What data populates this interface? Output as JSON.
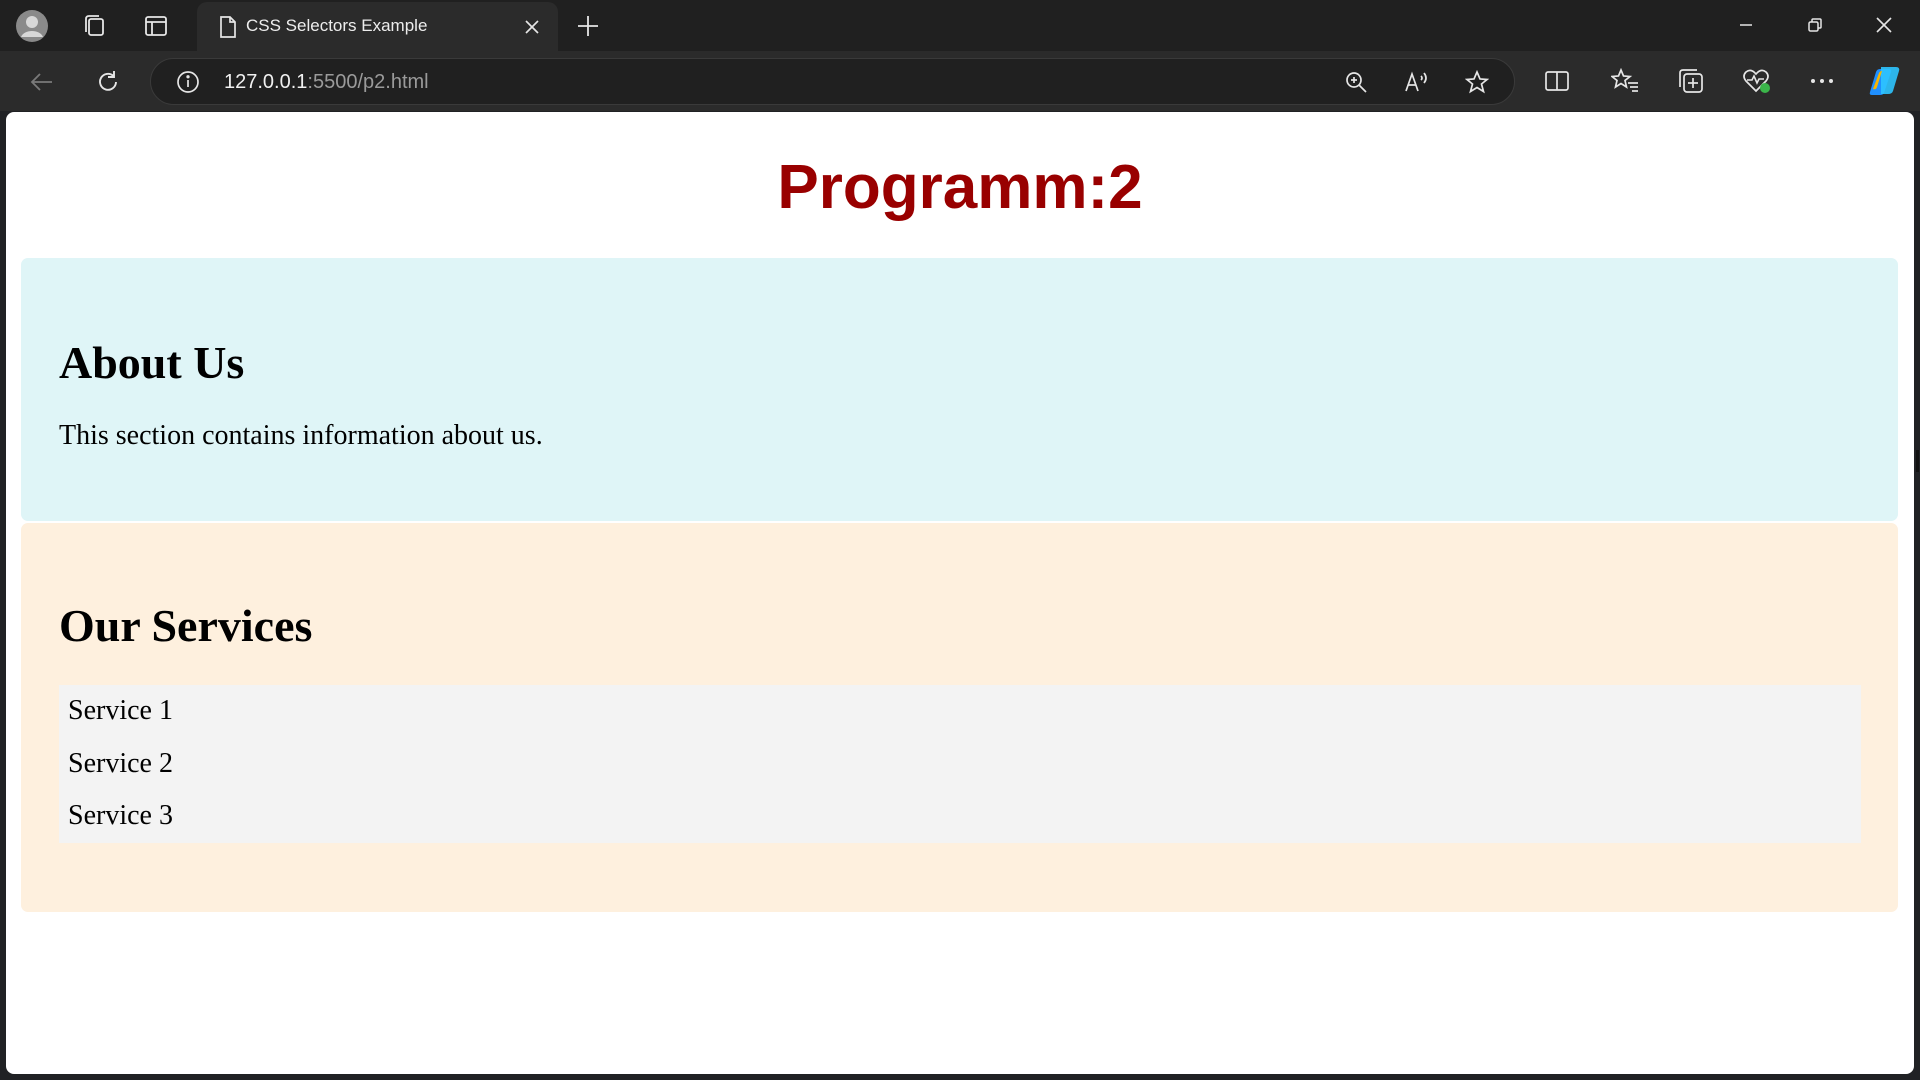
{
  "browser": {
    "tab": {
      "title": "CSS Selectors Example"
    },
    "address_bar": {
      "host": "127.0.0.1",
      "path": ":5500/p2.html"
    },
    "icons": {
      "profile": "profile-icon",
      "workspaces": "workspaces-icon",
      "tab_actions": "tab-actions-icon",
      "page": "page-icon",
      "tab_close": "close-icon",
      "new_tab": "plus-icon",
      "minimize": "minimize-icon",
      "restore": "restore-icon",
      "window_close": "close-icon",
      "back": "back-arrow-icon",
      "reload": "reload-icon",
      "site_info": "info-icon",
      "zoom": "zoom-icon",
      "read_aloud": "read-aloud-icon",
      "favorite": "star-icon",
      "split_screen": "split-screen-icon",
      "favorites": "favorites-icon",
      "collections": "collections-icon",
      "browser_essentials": "heart-pulse-icon",
      "more": "more-icon",
      "copilot": "copilot-icon"
    }
  },
  "page": {
    "heading": "Programm:2",
    "about": {
      "title": "About Us",
      "text": "This section contains information about us."
    },
    "services": {
      "title": "Our Services",
      "items": [
        "Service 1",
        "Service 2",
        "Service 3"
      ]
    }
  },
  "colors": {
    "heading": "#990000",
    "about_bg": "#dff5f7",
    "services_bg": "#fef0de",
    "list_bg": "#f3f3f3"
  }
}
